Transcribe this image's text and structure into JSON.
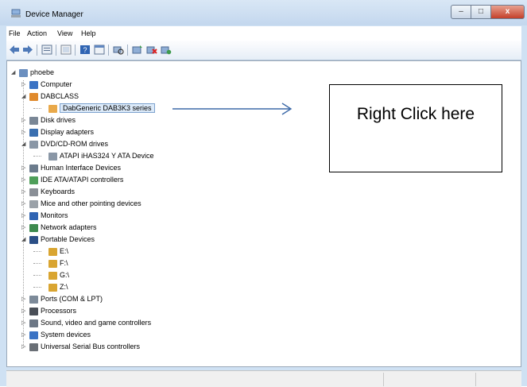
{
  "window": {
    "title": "Device Manager"
  },
  "controls": {
    "minimize": "–",
    "maximize": "□",
    "close": "x"
  },
  "menu": [
    "File",
    "Action",
    "View",
    "Help"
  ],
  "toolbar_icons": [
    "back-arrow-icon",
    "forward-arrow-icon",
    "properties-icon",
    "show-hidden-icon",
    "help-icon",
    "details-icon",
    "scan-hardware-icon",
    "update-driver-icon",
    "uninstall-icon",
    "disable-icon"
  ],
  "tree": [
    {
      "label": "phoebe",
      "level": 0,
      "expander": "◢",
      "icon": "computer-root-icon",
      "color": "#6b8fbf"
    },
    {
      "label": "Computer",
      "level": 1,
      "expander": "▷",
      "icon": "computer-icon",
      "color": "#3b73c4"
    },
    {
      "label": "DABCLASS",
      "level": 1,
      "expander": "◢",
      "icon": "dabclass-icon",
      "color": "#e08a2c"
    },
    {
      "label": "DabGeneric DAB3K3 series",
      "level": 2,
      "expander": "",
      "icon": "dab-device-icon",
      "color": "#e9a94a",
      "selected": true
    },
    {
      "label": "Disk drives",
      "level": 1,
      "expander": "▷",
      "icon": "disk-drive-icon",
      "color": "#7a8796"
    },
    {
      "label": "Display adapters",
      "level": 1,
      "expander": "▷",
      "icon": "display-adapter-icon",
      "color": "#3a6fb0"
    },
    {
      "label": "DVD/CD-ROM drives",
      "level": 1,
      "expander": "◢",
      "icon": "dvd-drive-icon",
      "color": "#8a97a6"
    },
    {
      "label": "ATAPI iHAS324   Y ATA Device",
      "level": 2,
      "expander": "",
      "icon": "dvd-device-icon",
      "color": "#8a97a6"
    },
    {
      "label": "Human Interface Devices",
      "level": 1,
      "expander": "▷",
      "icon": "hid-icon",
      "color": "#6b7b8c"
    },
    {
      "label": "IDE ATA/ATAPI controllers",
      "level": 1,
      "expander": "▷",
      "icon": "ide-controller-icon",
      "color": "#4f9f5a"
    },
    {
      "label": "Keyboards",
      "level": 1,
      "expander": "▷",
      "icon": "keyboard-icon",
      "color": "#8a8f96"
    },
    {
      "label": "Mice and other pointing devices",
      "level": 1,
      "expander": "▷",
      "icon": "mouse-icon",
      "color": "#9aa1a8"
    },
    {
      "label": "Monitors",
      "level": 1,
      "expander": "▷",
      "icon": "monitor-icon",
      "color": "#2f64b3"
    },
    {
      "label": "Network adapters",
      "level": 1,
      "expander": "▷",
      "icon": "network-adapter-icon",
      "color": "#3d8a4e"
    },
    {
      "label": "Portable Devices",
      "level": 1,
      "expander": "◢",
      "icon": "portable-devices-icon",
      "color": "#2b4f86"
    },
    {
      "label": "E:\\",
      "level": 2,
      "expander": "",
      "icon": "portable-drive-icon",
      "color": "#d9a531"
    },
    {
      "label": "F:\\",
      "level": 2,
      "expander": "",
      "icon": "portable-drive-icon",
      "color": "#d9a531"
    },
    {
      "label": "G:\\",
      "level": 2,
      "expander": "",
      "icon": "portable-drive-icon",
      "color": "#d9a531"
    },
    {
      "label": "Z:\\",
      "level": 2,
      "expander": "",
      "icon": "portable-drive-icon",
      "color": "#d9a531"
    },
    {
      "label": "Ports (COM & LPT)",
      "level": 1,
      "expander": "▷",
      "icon": "ports-icon",
      "color": "#7d8a99"
    },
    {
      "label": "Processors",
      "level": 1,
      "expander": "▷",
      "icon": "processor-icon",
      "color": "#4a4f57"
    },
    {
      "label": "Sound, video and game controllers",
      "level": 1,
      "expander": "▷",
      "icon": "sound-icon",
      "color": "#6c7785"
    },
    {
      "label": "System devices",
      "level": 1,
      "expander": "▷",
      "icon": "system-devices-icon",
      "color": "#3b73c4"
    },
    {
      "label": "Universal Serial Bus controllers",
      "level": 1,
      "expander": "▷",
      "icon": "usb-icon",
      "color": "#6a6f76"
    }
  ],
  "annotation": {
    "text": "Right Click here"
  }
}
